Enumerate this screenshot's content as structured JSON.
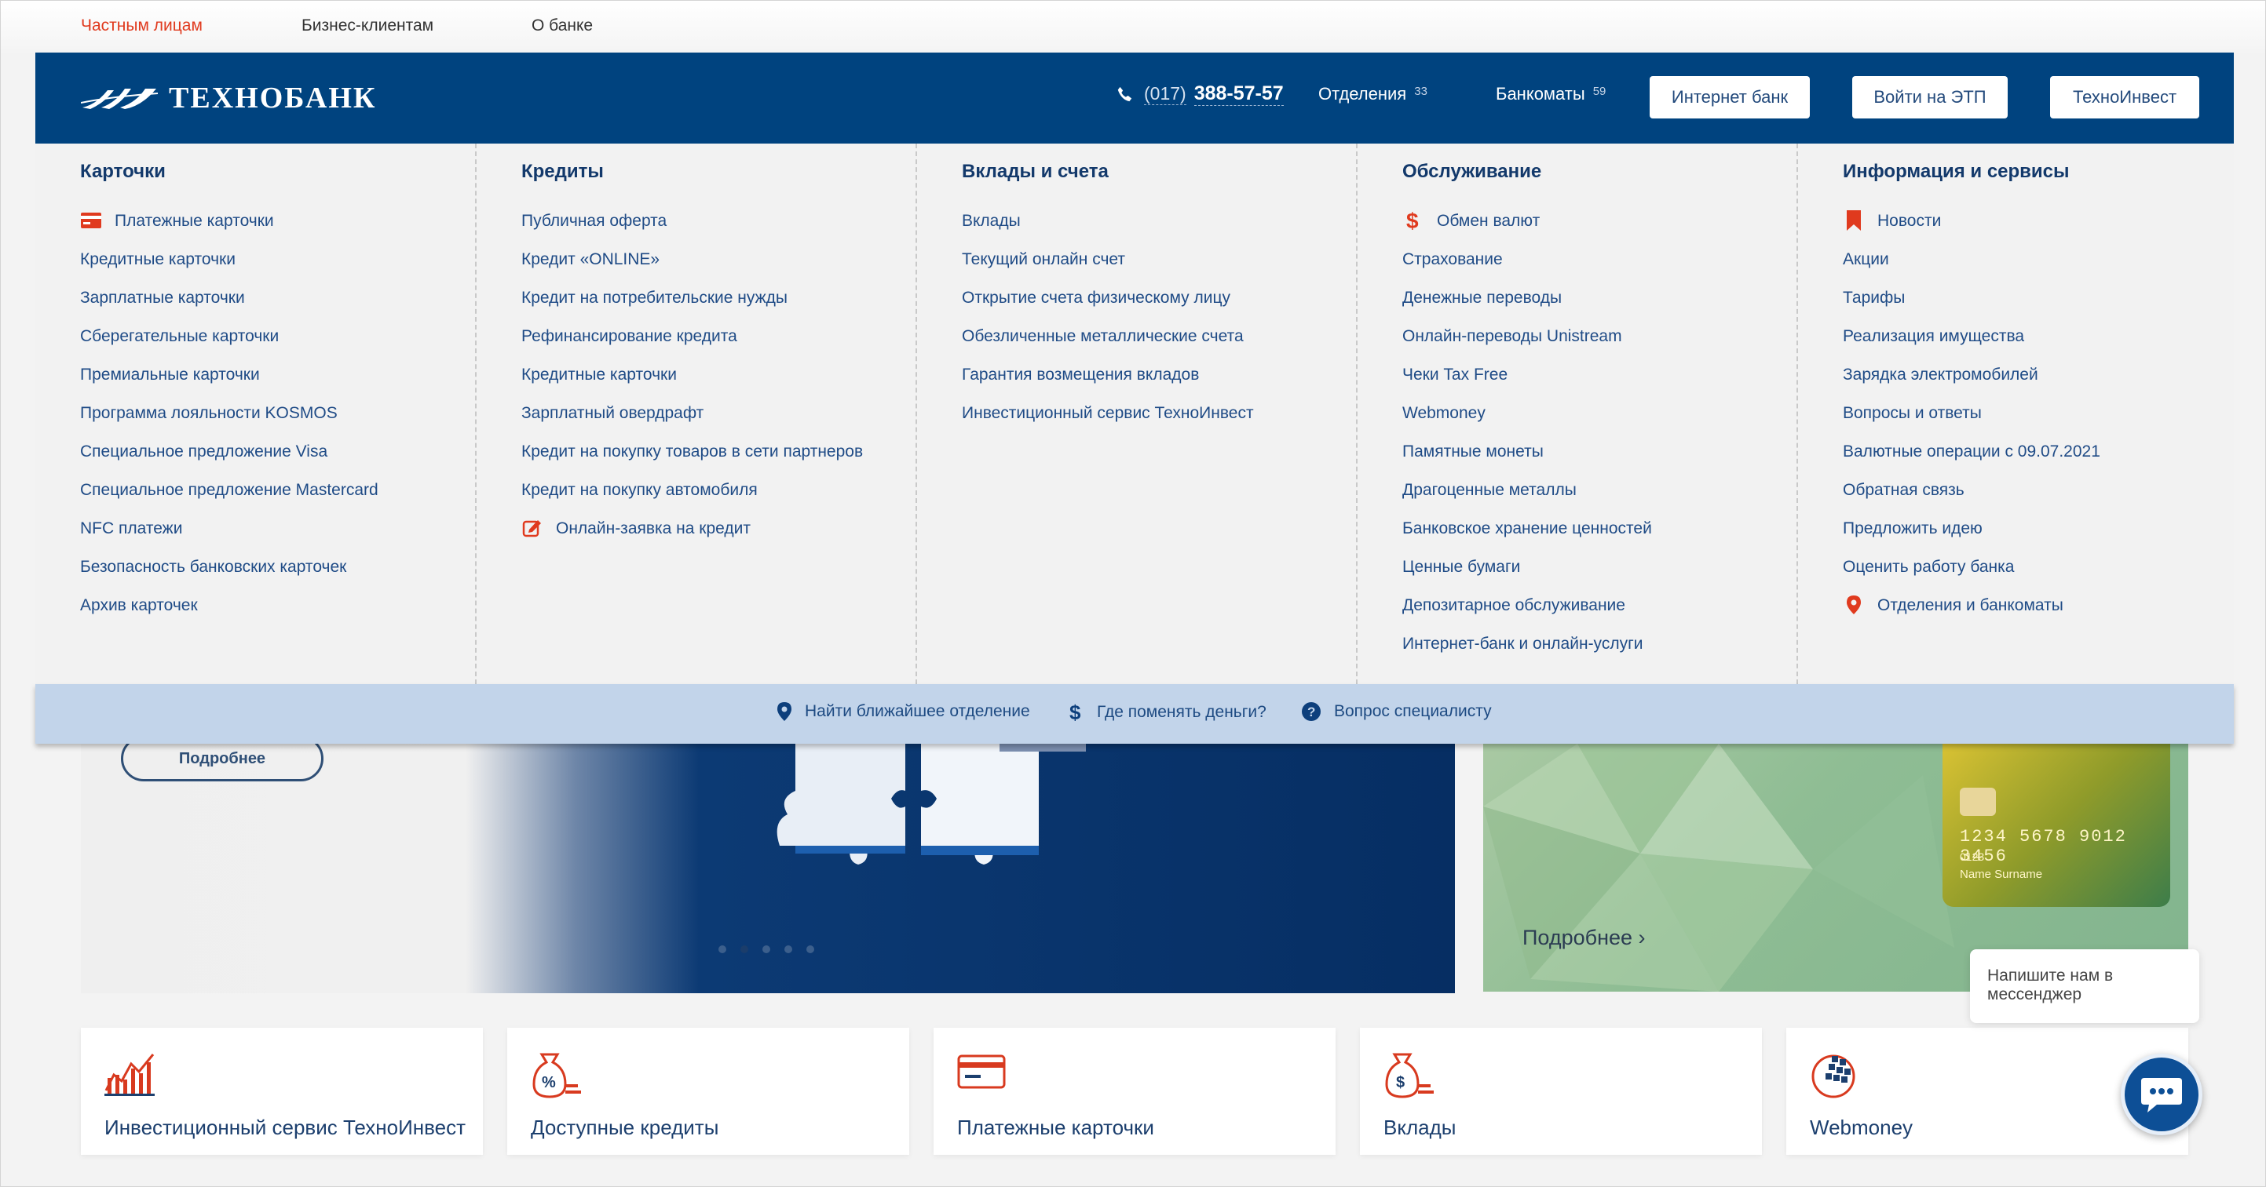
{
  "topnav": {
    "items": [
      {
        "label": "Частным лицам",
        "active": true
      },
      {
        "label": "Бизнес-клиентам",
        "active": false
      },
      {
        "label": "О банке",
        "active": false
      }
    ]
  },
  "header": {
    "logo_text": "ТЕХНОБАНК",
    "phone_code": "(017)",
    "phone_number": "388-57-57",
    "branches_label": "Отделения",
    "branches_count": "33",
    "atms_label": "Банкоматы",
    "atms_count": "59",
    "buttons": [
      "Интернет банк",
      "Войти на ЭТП",
      "ТехноИнвест"
    ]
  },
  "menu": {
    "columns": [
      {
        "title": "Карточки",
        "items": [
          "Платежные карточки",
          "Кредитные карточки",
          "Зарплатные карточки",
          "Сберегательные карточки",
          "Премиальные карточки",
          "Программа лояльности KOSMOS",
          "Специальное предложение Visa",
          "Специальное предложение Mastercard",
          "NFC платежи",
          "Безопасность банковских карточек",
          "Архив карточек"
        ]
      },
      {
        "title": "Кредиты",
        "items": [
          "Публичная оферта",
          "Кредит «ONLINE»",
          "Кредит на потребительские нужды",
          "Рефинансирование кредита",
          "Кредитные карточки",
          "Зарплатный овердрафт",
          "Кредит на покупку товаров в сети партнеров",
          "Кредит на покупку автомобиля",
          "Онлайн-заявка на кредит"
        ]
      },
      {
        "title": "Вклады и счета",
        "items": [
          "Вклады",
          "Текущий онлайн счет",
          "Открытие счета физическому лицу",
          "Обезличенные металлические счета",
          "Гарантия возмещения вкладов",
          "Инвестиционный сервис ТехноИнвест"
        ]
      },
      {
        "title": "Обслуживание",
        "items": [
          "Обмен валют",
          "Страхование",
          "Денежные переводы",
          "Онлайн-переводы Unistream",
          "Чеки Tax Free",
          "Webmoney",
          "Памятные монеты",
          "Драгоценные металлы",
          "Банковское хранение ценностей",
          "Ценные бумаги",
          "Депозитарное обслуживание",
          "Интернет-банк и онлайн-услуги"
        ]
      },
      {
        "title": "Информация и сервисы",
        "items": [
          "Новости",
          "Акции",
          "Тарифы",
          "Реализация имущества",
          "Зарядка электромобилей",
          "Вопросы и ответы",
          "Валютные операции с 09.07.2021",
          "Обратная связь",
          "Предложить идею",
          "Оценить работу банка",
          "Отделения и банкоматы"
        ]
      }
    ],
    "icons": {
      "card-icon": "Платежные карточки",
      "edit-icon": "Онлайн-заявка на кредит",
      "dollar-icon": "Обмен валют",
      "bookmark-icon": "Новости",
      "location-pin-icon": "Отделения и банкоматы"
    },
    "accent_color": "#e03a1e"
  },
  "quickbar": {
    "links": [
      "Найти ближайшее отделение",
      "Где поменять деньги?",
      "Вопрос специалисту"
    ]
  },
  "background": {
    "more_button": "Подробнее",
    "more_link": "Подробнее ›",
    "card_number": "1234 5678 9012 3456",
    "card_small": "0123",
    "card_name": "Name Surname"
  },
  "tiles": [
    {
      "label": "Инвестиционный сервис ТехноИнвест",
      "icon": "chart-icon"
    },
    {
      "label": "Доступные кредиты",
      "icon": "money-bag-percent-icon"
    },
    {
      "label": "Платежные карточки",
      "icon": "card-icon"
    },
    {
      "label": "Вклады",
      "icon": "money-bag-dollar-icon"
    },
    {
      "label": "Webmoney",
      "icon": "webmoney-icon"
    }
  ],
  "chat": {
    "bubble_text": "Напишите нам в мессенджер"
  },
  "colors": {
    "header_blue": "#00437f",
    "quickbar_blue": "#c2d4ea",
    "link_blue": "#1f4b86",
    "accent_red": "#e03a1e"
  }
}
